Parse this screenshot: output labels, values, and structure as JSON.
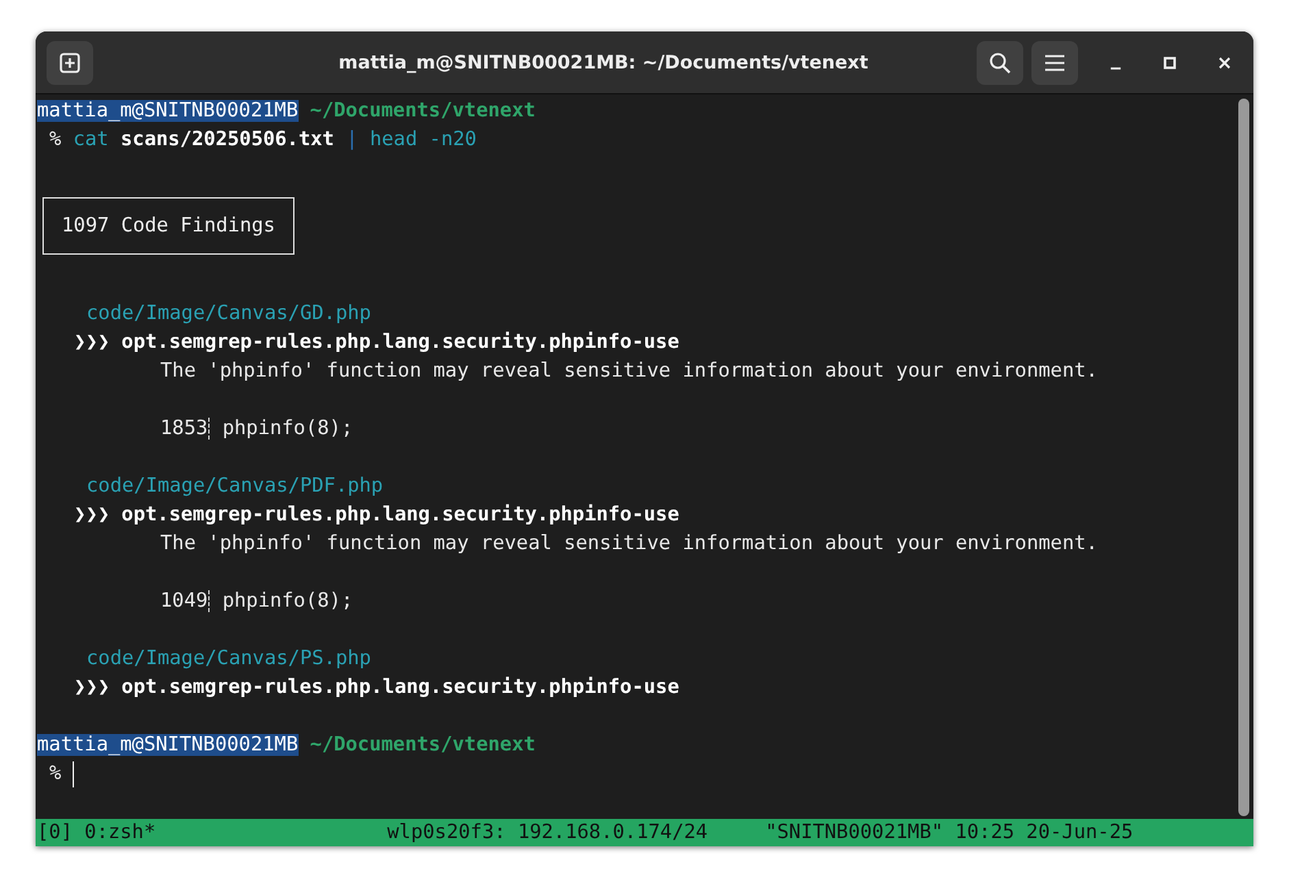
{
  "window": {
    "title": "mattia_m@SNITNB00021MB: ~/Documents/vtenext"
  },
  "lines": [
    {
      "kind": "prompt",
      "user": "mattia_m@SNITNB00021MB",
      "path": "~/Documents/vtenext"
    },
    {
      "kind": "command",
      "symbol": "%",
      "parts": [
        {
          "kind": "cmd",
          "text": "cat"
        },
        {
          "kind": "arg",
          "text": "scans/20250506.txt"
        },
        {
          "kind": "pipe",
          "text": "|"
        },
        {
          "kind": "cmd",
          "text": "head -n20"
        }
      ]
    },
    {
      "kind": "blank"
    },
    {
      "kind": "box",
      "text": "1097 Code Findings"
    },
    {
      "kind": "blank"
    },
    {
      "kind": "file",
      "text": "code/Image/Canvas/GD.php"
    },
    {
      "kind": "rule",
      "marker": "❯❯❯",
      "text": "opt.semgrep-rules.php.lang.security.phpinfo-use"
    },
    {
      "kind": "message",
      "text": "The 'phpinfo' function may reveal sensitive information about your environment."
    },
    {
      "kind": "blank"
    },
    {
      "kind": "code",
      "number": "1853",
      "text": "phpinfo(8);"
    },
    {
      "kind": "blank"
    },
    {
      "kind": "file",
      "text": "code/Image/Canvas/PDF.php"
    },
    {
      "kind": "rule",
      "marker": "❯❯❯",
      "text": "opt.semgrep-rules.php.lang.security.phpinfo-use"
    },
    {
      "kind": "message",
      "text": "The 'phpinfo' function may reveal sensitive information about your environment."
    },
    {
      "kind": "blank"
    },
    {
      "kind": "code",
      "number": "1049",
      "text": "phpinfo(8);"
    },
    {
      "kind": "blank"
    },
    {
      "kind": "file",
      "text": "code/Image/Canvas/PS.php"
    },
    {
      "kind": "rule",
      "marker": "❯❯❯",
      "text": "opt.semgrep-rules.php.lang.security.phpinfo-use"
    },
    {
      "kind": "blank"
    },
    {
      "kind": "prompt",
      "user": "mattia_m@SNITNB00021MB",
      "path": "~/Documents/vtenext"
    },
    {
      "kind": "input",
      "symbol": "%"
    }
  ],
  "status_bar": {
    "session": "[0] 0:zsh*",
    "network": "wlp0s20f3: 192.168.0.174/24",
    "host_time": "\"SNITNB00021MB\" 10:25 20-Jun-25"
  }
}
